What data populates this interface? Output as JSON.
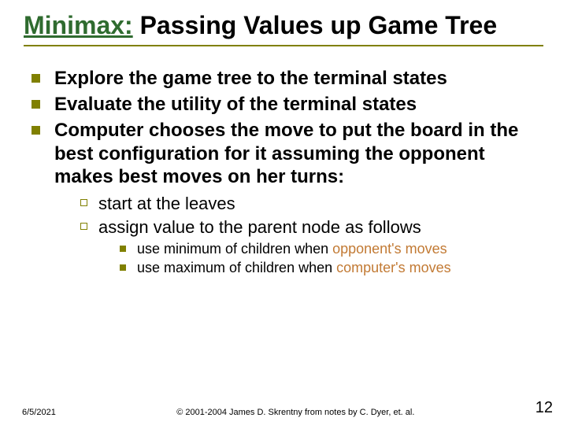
{
  "title_highlight": "Minimax:",
  "title_rest": " Passing Values up Game Tree",
  "bullets_lvl1": [
    "Explore the game tree to the terminal states",
    "Evaluate the utility of the terminal states",
    "Computer chooses the move to put the board in the best configuration for it assuming the opponent makes best moves on her turns:"
  ],
  "bullets_lvl2": [
    "start at the leaves",
    "assign value to the parent node as follows"
  ],
  "bullets_lvl3": [
    {
      "pre": "use minimum of children when ",
      "accent": "opponent's moves",
      "post": ""
    },
    {
      "pre": "use maximum of children when ",
      "accent": "computer's moves",
      "post": ""
    }
  ],
  "footer": {
    "date": "6/5/2021",
    "copyright": "© 2001-2004 James D. Skrentny from notes by C. Dyer, et. al.",
    "page": "12"
  }
}
